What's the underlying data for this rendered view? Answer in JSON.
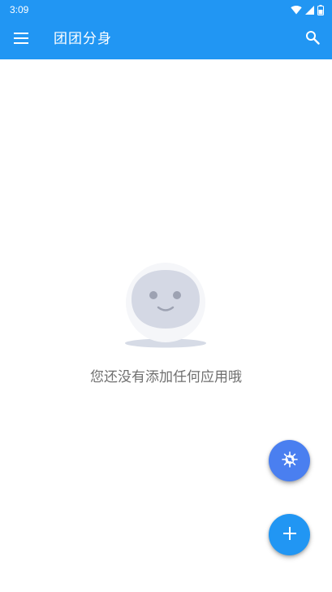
{
  "status_bar": {
    "time": "3:09",
    "icons": [
      "wifi-icon",
      "cellular-signal-icon",
      "battery-icon"
    ]
  },
  "app_bar": {
    "title": "团团分身",
    "menu_icon": "hamburger-menu-icon",
    "search_icon": "search-icon"
  },
  "empty_state": {
    "illustration": "smiling-face-icon",
    "message": "您还没有添加任何应用哦"
  },
  "fabs": {
    "virus_icon": "virus-icon",
    "add_icon": "plus-icon"
  },
  "colors": {
    "primary": "#2196f3",
    "fab_secondary": "#4a7ff0",
    "empty_text": "#6f6f6f",
    "illustration_face": "#d4d8e4"
  }
}
